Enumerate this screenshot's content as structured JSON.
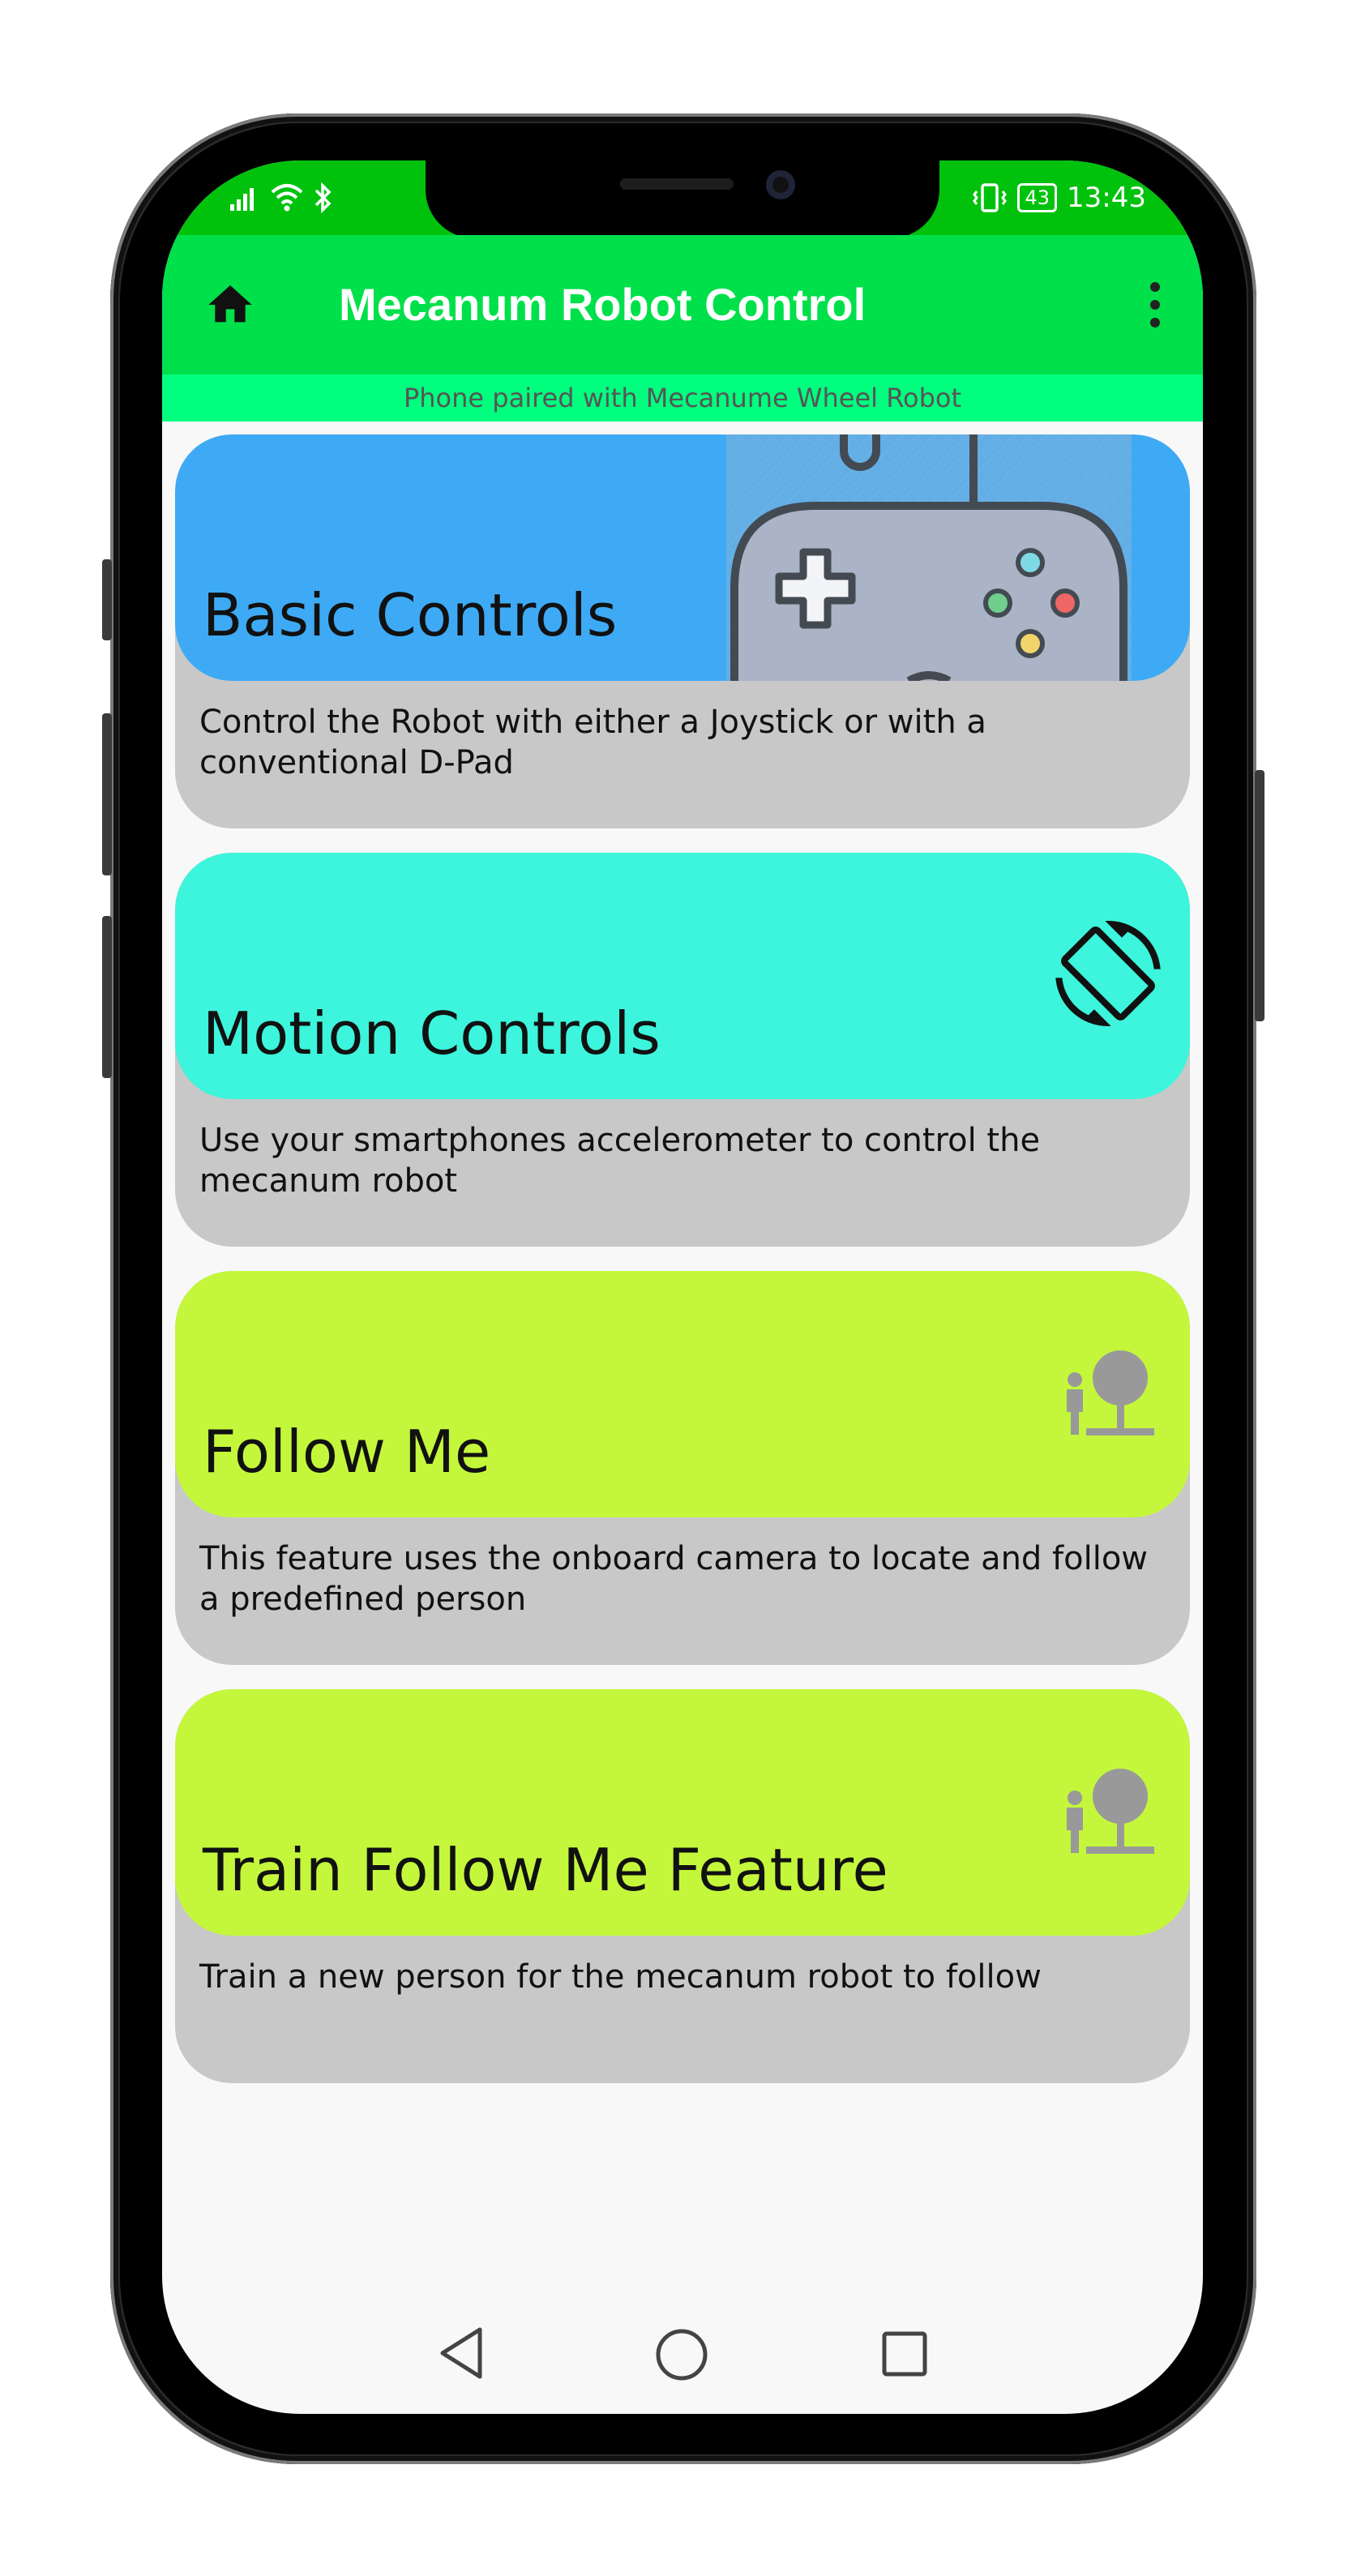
{
  "status_bar": {
    "time": "13:43",
    "battery": "43"
  },
  "app_bar": {
    "title": "Mecanum Robot Control",
    "home_icon": "home-icon",
    "menu_icon": "more-vert-icon"
  },
  "pair_status": "Phone paired with Mecanume Wheel Robot",
  "cards": [
    {
      "title": "Basic Controls",
      "description": "Control the Robot with either a Joystick or with a conventional D-Pad",
      "color": "#3eaaf5",
      "icon": "gamepad-icon"
    },
    {
      "title": "Motion Controls",
      "description": "Use your smartphones accelerometer to control the mecanum robot",
      "color": "#3cf5dc",
      "icon": "screen-rotation-icon"
    },
    {
      "title": "Follow Me",
      "description": "This feature uses the onboard camera to locate and follow a predefined person",
      "color": "#c4f73c",
      "icon": "person-follow-icon"
    },
    {
      "title": "Train Follow Me Feature",
      "description": "Train a new person for the mecanum robot to follow",
      "color": "#c4f73c",
      "icon": "person-follow-icon"
    }
  ],
  "nav_bar": {
    "back_icon": "back-triangle-icon",
    "home_icon": "home-circle-icon",
    "recents_icon": "recents-square-icon"
  },
  "colors": {
    "status_bar": "#00c20d",
    "app_bar": "#00e04a",
    "pair_bar": "#00ff7f",
    "card_body": "#c8c8c8"
  }
}
